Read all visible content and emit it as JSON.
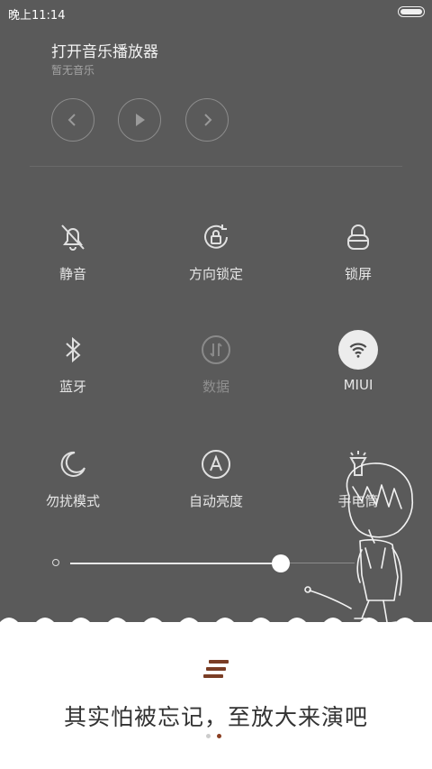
{
  "status_bar": {
    "time": "晚上11:14"
  },
  "music": {
    "title": "打开音乐播放器",
    "subtitle": "暂无音乐",
    "controls": {
      "prev_icon": "chevron-left-icon",
      "play_icon": "play-icon",
      "next_icon": "chevron-right-icon"
    }
  },
  "toggles": [
    {
      "label": "静音",
      "icon": "bell-off-icon",
      "state": "off"
    },
    {
      "label": "方向锁定",
      "icon": "rotation-lock-icon",
      "state": "off"
    },
    {
      "label": "锁屏",
      "icon": "lock-icon",
      "state": "off"
    },
    {
      "label": "蓝牙",
      "icon": "bluetooth-icon",
      "state": "off"
    },
    {
      "label": "数据",
      "icon": "mobile-data-icon",
      "state": "disabled"
    },
    {
      "label": "MIUI",
      "icon": "wifi-icon",
      "state": "on"
    },
    {
      "label": "勿扰模式",
      "icon": "moon-icon",
      "state": "off"
    },
    {
      "label": "自动亮度",
      "icon": "auto-brightness-icon",
      "state": "off"
    },
    {
      "label": "手电筒",
      "icon": "flashlight-icon",
      "state": "off"
    }
  ],
  "brightness": {
    "level_fraction": 0.74
  },
  "banner": {
    "slogan": "其实怕被忘记，至放大来演吧",
    "pager": {
      "count": 2,
      "active_index": 1
    }
  },
  "colors": {
    "panel_bg": "#5a5a5a",
    "accent_brown": "#7a3d25",
    "active_toggle_bg": "#ececec"
  }
}
